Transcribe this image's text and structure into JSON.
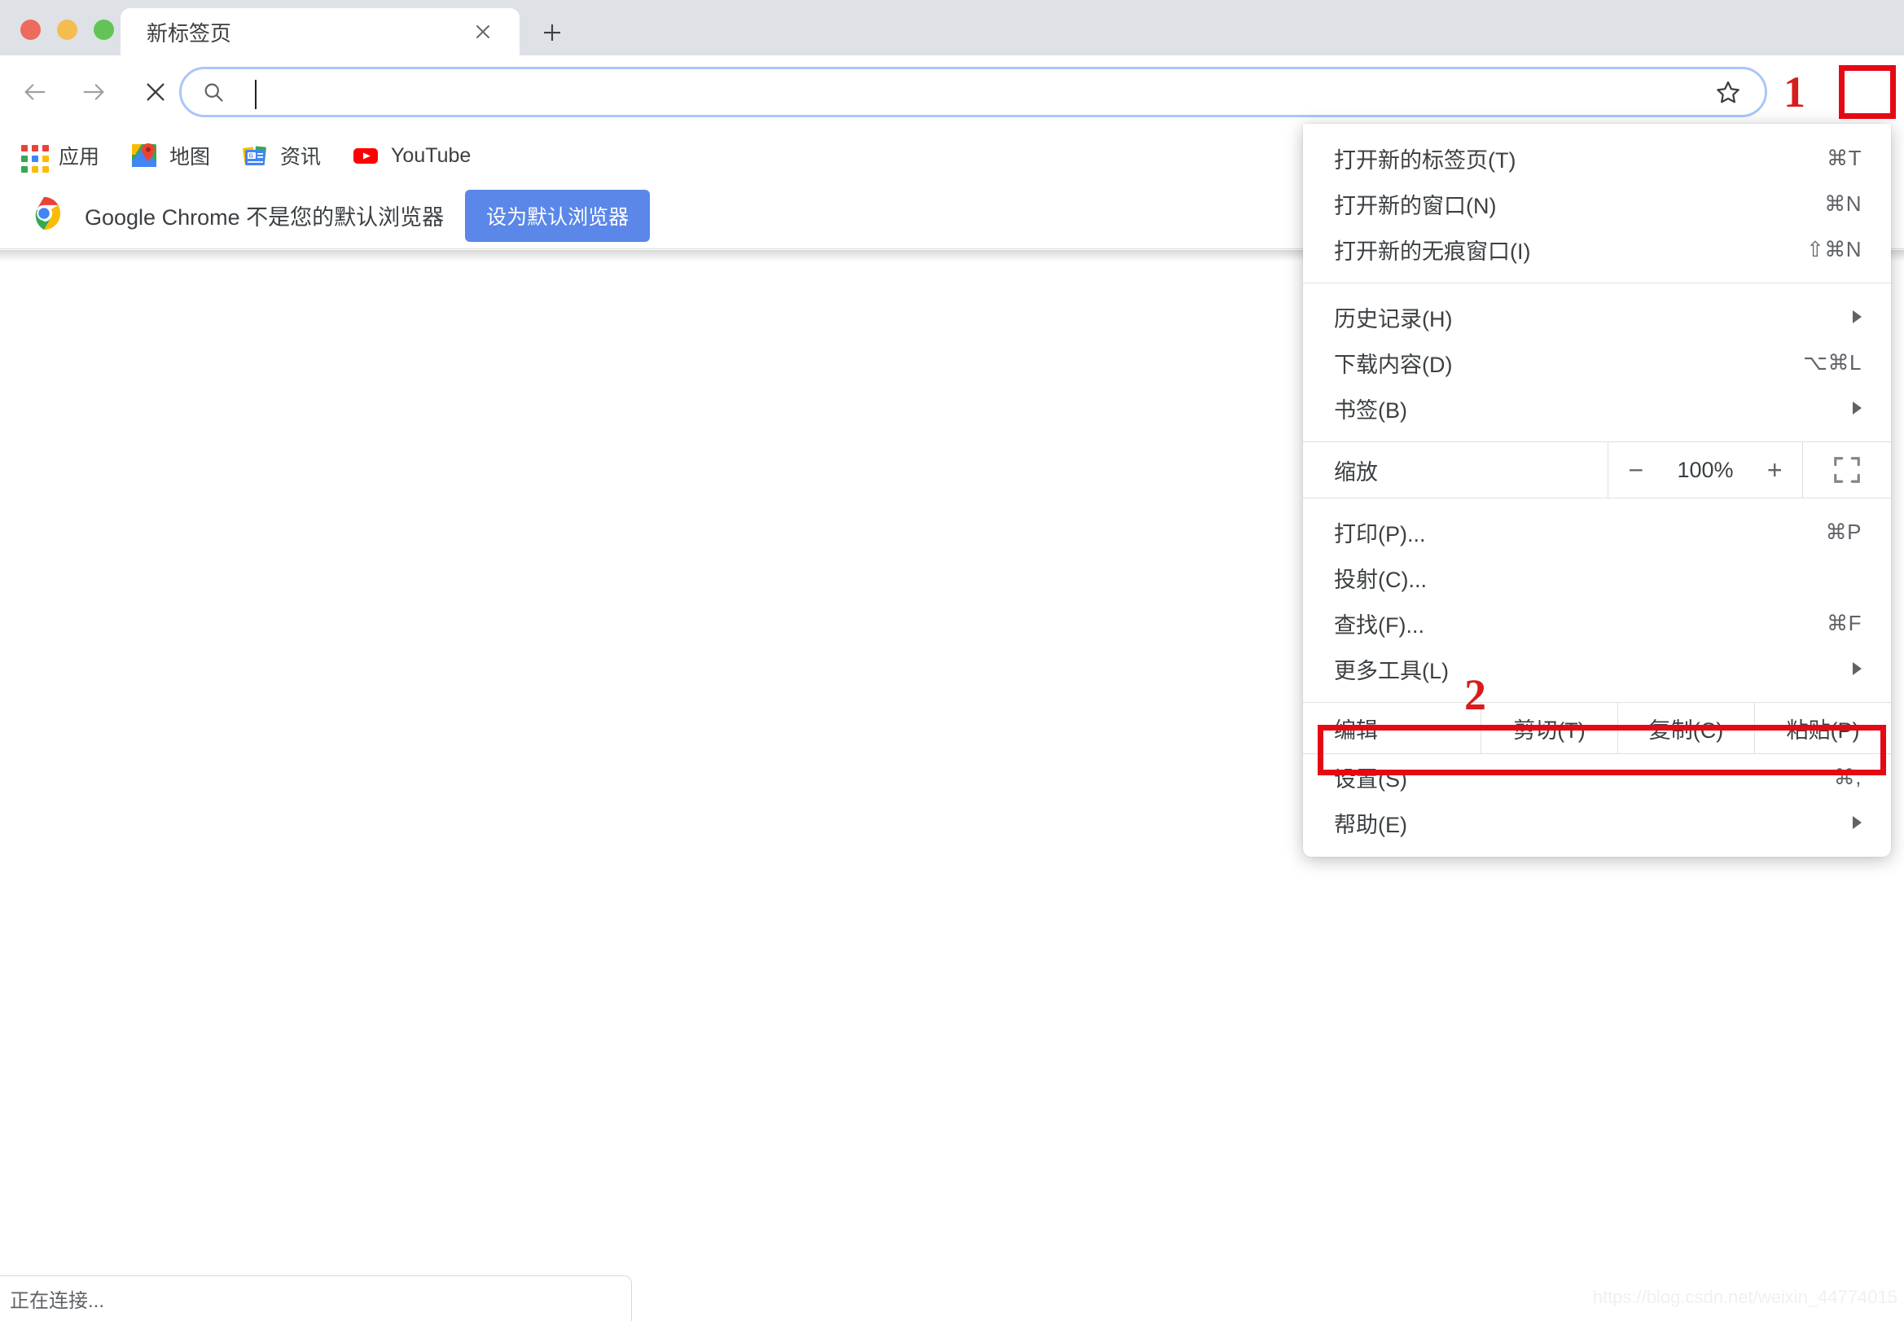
{
  "window": {
    "traffic_lights": [
      {
        "name": "close",
        "color": "#ec6a5e"
      },
      {
        "name": "minimize",
        "color": "#f4bd4f"
      },
      {
        "name": "maximize",
        "color": "#61c454"
      }
    ]
  },
  "tabstrip": {
    "tab_title": "新标签页",
    "close_glyph": "✕",
    "newtab_glyph": "+"
  },
  "toolbar": {
    "back_glyph": "←",
    "forward_glyph": "→",
    "stop_glyph": "✕",
    "omnibox_value": "",
    "omnibox_placeholder": "",
    "star_glyph": "☆"
  },
  "bookmarks": [
    {
      "label": "应用",
      "icon": "apps-grid-icon"
    },
    {
      "label": "地图",
      "icon": "google-maps-icon"
    },
    {
      "label": "资讯",
      "icon": "google-news-icon"
    },
    {
      "label": "YouTube",
      "icon": "youtube-icon"
    }
  ],
  "infobar": {
    "text": "Google Chrome 不是您的默认浏览器",
    "button": "设为默认浏览器",
    "brand_color": "#5a87e8"
  },
  "menu": {
    "group1": [
      {
        "label": "打开新的标签页(T)",
        "accel": "⌘T",
        "arrow": false
      },
      {
        "label": "打开新的窗口(N)",
        "accel": "⌘N",
        "arrow": false
      },
      {
        "label": "打开新的无痕窗口(I)",
        "accel": "⇧⌘N",
        "arrow": false
      }
    ],
    "group2": [
      {
        "label": "历史记录(H)",
        "accel": "",
        "arrow": true
      },
      {
        "label": "下载内容(D)",
        "accel": "⌥⌘L",
        "arrow": false
      },
      {
        "label": "书签(B)",
        "accel": "",
        "arrow": true
      }
    ],
    "zoom": {
      "label": "缩放",
      "minus": "−",
      "value": "100%",
      "plus": "+",
      "fullscreen_icon": "fullscreen-icon"
    },
    "group3": [
      {
        "label": "打印(P)...",
        "accel": "⌘P",
        "arrow": false
      },
      {
        "label": "投射(C)...",
        "accel": "",
        "arrow": false
      },
      {
        "label": "查找(F)...",
        "accel": "⌘F",
        "arrow": false
      },
      {
        "label": "更多工具(L)",
        "accel": "",
        "arrow": true
      }
    ],
    "edit_row": {
      "label": "编辑",
      "cut": "剪切(T)",
      "copy": "复制(C)",
      "paste": "粘贴(P)"
    },
    "group4": [
      {
        "label": "设置(S)",
        "accel": "⌘,",
        "arrow": false
      },
      {
        "label": "帮助(E)",
        "accel": "",
        "arrow": true
      }
    ]
  },
  "annotations": {
    "step1": "1",
    "step2": "2",
    "highlight_color": "#e50914"
  },
  "status": {
    "text": "正在连接..."
  },
  "watermark": {
    "text": "https://blog.csdn.net/weixin_44774015"
  }
}
